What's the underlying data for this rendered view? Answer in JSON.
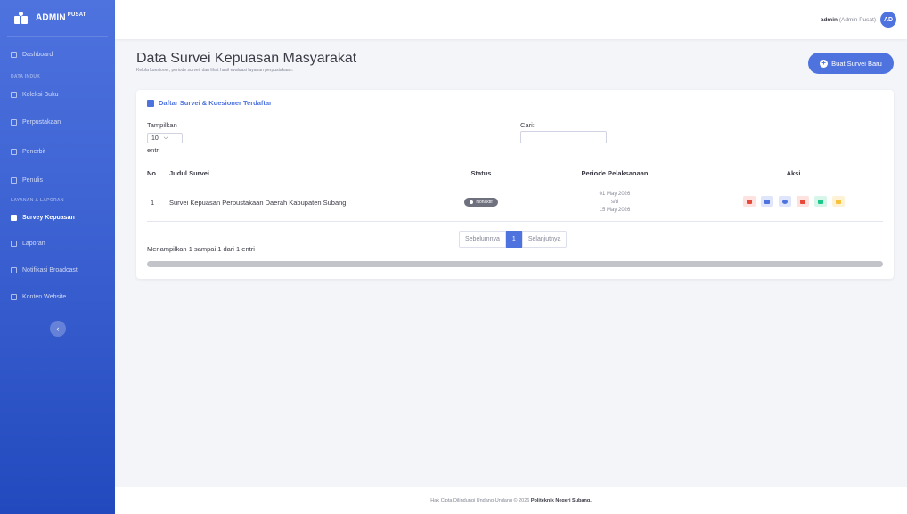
{
  "sidebar": {
    "brand": "ADMIN",
    "brand_sup": "PUSAT",
    "items": [
      {
        "label": "Dashboard"
      },
      {
        "head": "DATA INDUK"
      },
      {
        "label": "Koleksi Buku"
      },
      {
        "label": "Perpustakaan"
      },
      {
        "label": "Penerbit"
      },
      {
        "label": "Penulis"
      },
      {
        "head": "LAYANAN & LAPORAN"
      },
      {
        "label": "Survey Kepuasan"
      },
      {
        "label": "Laporan"
      },
      {
        "label": "Notifikasi Broadcast"
      },
      {
        "label": "Konten Website"
      }
    ],
    "toggle": "‹"
  },
  "topbar": {
    "user_name": "admin",
    "user_role": "(Admin Pusat)",
    "avatar_text": "AD"
  },
  "page": {
    "title": "Data Survei Kepuasan Masyarakat",
    "subtitle": "Kelola kuesioner, periode survei, dan lihat hasil evaluasi layanan perpustakaan.",
    "new_button": "Buat Survei Baru"
  },
  "card": {
    "title": "Daftar Survei & Kuesioner Terdaftar",
    "show_label": "Tampilkan",
    "show_value": "10",
    "entries_label": "entri",
    "search_label": "Cari:",
    "columns": [
      "No",
      "Judul Survei",
      "Status",
      "Periode Pelaksanaan",
      "Aksi"
    ],
    "rows": [
      {
        "no": "1",
        "title": "Survei Kepuasan Perpustakaan Daerah Kabupaten Subang",
        "status": "Nonaktif",
        "period_start": "01 May 2026",
        "period_sep": "s/d",
        "period_end": "15 May 2026"
      }
    ],
    "info": "Menampilkan 1 sampai 1 dari 1 entri",
    "pager": {
      "prev": "Sebelumnya",
      "current": "1",
      "next": "Selanjutnya"
    },
    "action_icons": [
      "toggle-icon",
      "list-icon",
      "chart-icon",
      "pdf-icon",
      "share-icon",
      "edit-icon"
    ]
  },
  "footer": {
    "text": "Hak Cipta Dilindungi Undang-Undang © 2026",
    "org": "Politeknik Negeri Subang."
  },
  "colors": {
    "primary": "#4e73df",
    "danger": "#e74a3b",
    "info": "#36b9cc",
    "success": "#1cc88a",
    "warning": "#f6c23e",
    "secondary": "#6e707e"
  }
}
